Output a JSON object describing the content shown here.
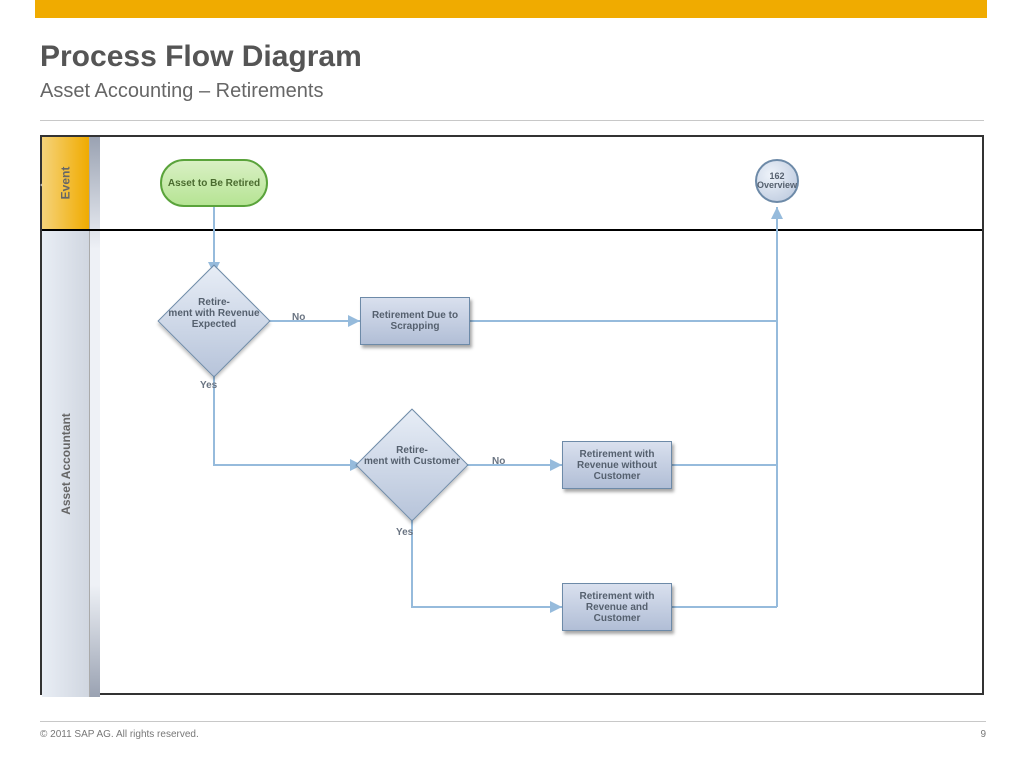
{
  "header": {
    "title": "Process Flow Diagram",
    "subtitle": "Asset Accounting – Retirements"
  },
  "lanes": {
    "event": "Event",
    "accountant": "Asset Accountant"
  },
  "nodes": {
    "start": "Asset to Be Retired",
    "end": "162 Overview",
    "decision1": "Retire-\nment with Revenue Expected",
    "decision2": "Retire-\nment with Customer",
    "process_scrap": "Retirement Due to Scrapping",
    "process_no_cust": "Retirement with Revenue without Customer",
    "process_with_cust": "Retirement with Revenue and Customer"
  },
  "edges": {
    "no": "No",
    "yes": "Yes"
  },
  "footer": {
    "copyright": "©  2011 SAP AG. All rights reserved.",
    "page": "9"
  },
  "colors": {
    "brand": "#f0ab00",
    "connector": "#96bbdc",
    "node_border": "#6d8aa8"
  }
}
